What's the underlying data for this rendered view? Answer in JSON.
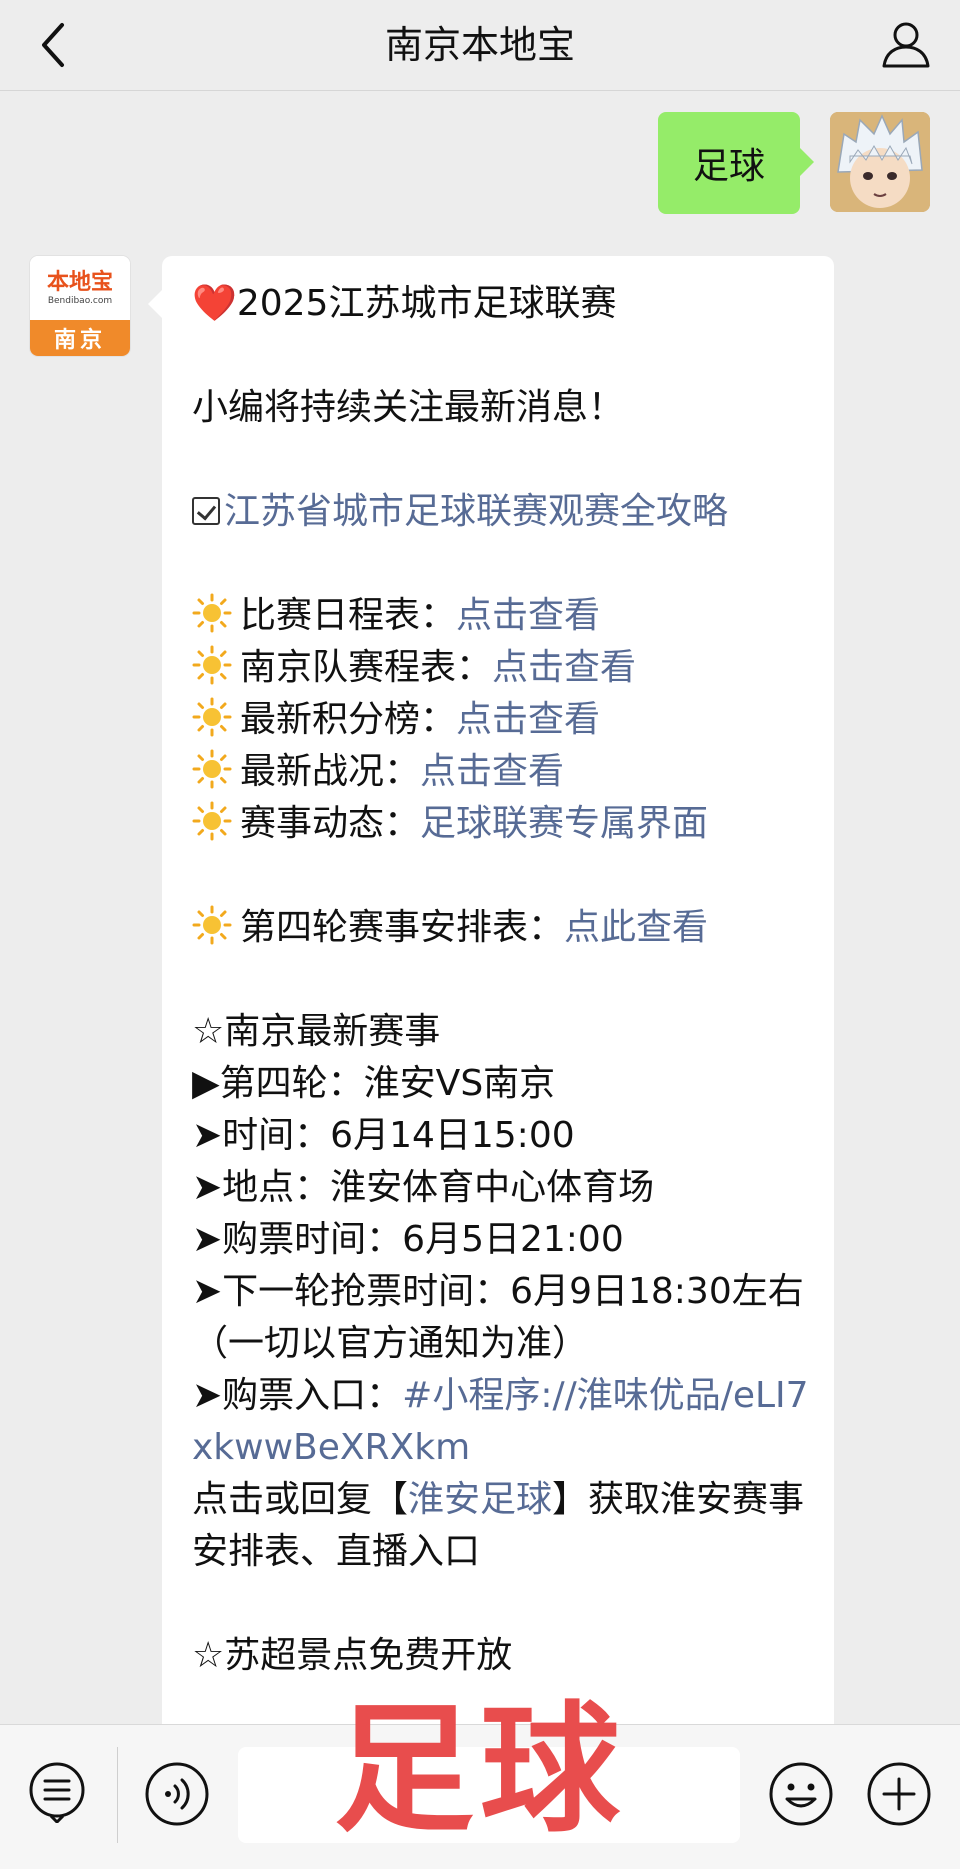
{
  "header": {
    "title": "南京本地宝"
  },
  "outgoing": {
    "text": "足球"
  },
  "bot": {
    "logo_name": "本地宝",
    "logo_sub": "Bendibao.com",
    "logo_city": "南京"
  },
  "message": {
    "title_heart": "❤️",
    "title": "2025江苏城市足球联赛",
    "follow": "小编将持续关注最新消息！",
    "guide_link": "江苏省城市足球联赛观赛全攻略",
    "items": [
      {
        "label": "比赛日程表：",
        "link": "点击查看"
      },
      {
        "label": "南京队赛程表：",
        "link": "点击查看"
      },
      {
        "label": "最新积分榜：",
        "link": "点击查看"
      },
      {
        "label": "最新战况：",
        "link": "点击查看"
      },
      {
        "label": "赛事动态：",
        "link": "足球联赛专属界面"
      }
    ],
    "round4_label": "第四轮赛事安排表：",
    "round4_link": "点此查看",
    "nanjing_heading": "☆南京最新赛事",
    "match_line": "▶第四轮：淮安VS南京",
    "time_line": "➤时间：6月14日15:00",
    "place_line": "➤地点：淮安体育中心体育场",
    "ticket_time_line": "➤购票时间：6月5日21:00",
    "next_ticket_line": "➤下一轮抢票时间：6月9日18:30左右（一切以官方通知为准）",
    "ticket_entry_label": "➤购票入口：",
    "ticket_entry_link": "#小程序://淮味优品/eLI7xkwwBeXRXkm",
    "reply_prefix": "点击或回复【",
    "reply_link": "淮安足球",
    "reply_suffix": "】获取淮安赛事安排表、直播入口",
    "scenic_heading": "☆苏超景点免费开放"
  },
  "overlay": {
    "caption": "足球"
  },
  "colors": {
    "bubble_out": "#95ec69",
    "link": "#576b95",
    "overlay": "#e84d4d"
  }
}
